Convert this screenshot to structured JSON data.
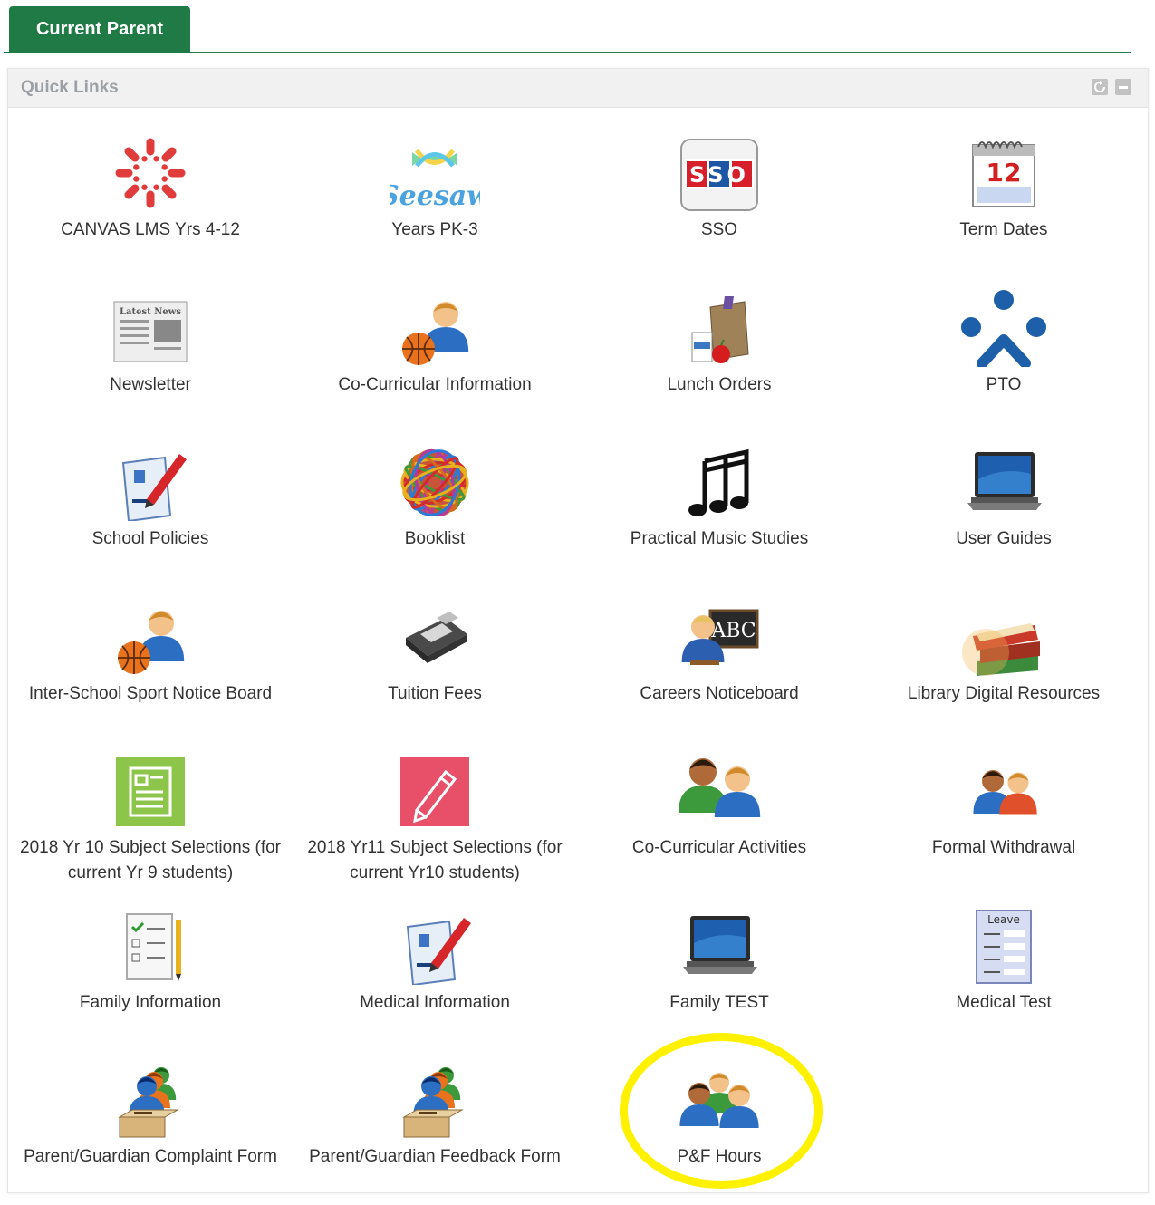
{
  "tab": {
    "label": "Current Parent"
  },
  "panel": {
    "title": "Quick Links"
  },
  "links": [
    {
      "label": "CANVAS LMS Yrs 4-12",
      "icon": "canvas-logo-icon"
    },
    {
      "label": "Years PK-3",
      "icon": "seesaw-logo-icon",
      "logo_text": "Seesaw"
    },
    {
      "label": "SSO",
      "icon": "sso-icon",
      "logo_text": "SSO"
    },
    {
      "label": "Term Dates",
      "icon": "calendar-icon",
      "logo_text": "12"
    },
    {
      "label": "Newsletter",
      "icon": "newspaper-icon",
      "logo_text": "Latest News"
    },
    {
      "label": "Co-Curricular Information",
      "icon": "person-basketball-icon"
    },
    {
      "label": "Lunch Orders",
      "icon": "lunch-bag-icon"
    },
    {
      "label": "PTO",
      "icon": "pto-logo-icon"
    },
    {
      "label": "School Policies",
      "icon": "document-pen-icon"
    },
    {
      "label": "Booklist",
      "icon": "rubber-band-ball-icon"
    },
    {
      "label": "Practical Music Studies",
      "icon": "music-notes-icon"
    },
    {
      "label": "User Guides",
      "icon": "laptop-icon"
    },
    {
      "label": "Inter-School Sport Notice Board",
      "icon": "person-basketball-icon"
    },
    {
      "label": "Tuition Fees",
      "icon": "card-terminal-icon"
    },
    {
      "label": "Careers Noticeboard",
      "icon": "teacher-abc-icon",
      "logo_text": "ABC"
    },
    {
      "label": "Library Digital Resources",
      "icon": "books-icon"
    },
    {
      "label": "2018 Yr 10 Subject Selections (for current Yr 9 students)",
      "icon": "green-document-icon"
    },
    {
      "label": "2018 Yr11 Subject Selections (for current Yr10 students)",
      "icon": "pink-pencil-icon"
    },
    {
      "label": "Co-Curricular Activities",
      "icon": "two-people-icon"
    },
    {
      "label": "Formal Withdrawal",
      "icon": "two-people-small-icon"
    },
    {
      "label": "Family Information",
      "icon": "checklist-icon"
    },
    {
      "label": "Medical Information",
      "icon": "document-pen-icon"
    },
    {
      "label": "Family TEST",
      "icon": "laptop-icon"
    },
    {
      "label": "Medical Test",
      "icon": "leave-form-icon",
      "logo_text": "Leave"
    },
    {
      "label": "Parent/Guardian Complaint Form",
      "icon": "people-ballot-icon"
    },
    {
      "label": "Parent/Guardian Feedback Form",
      "icon": "people-ballot-icon"
    },
    {
      "label": "P&F Hours",
      "icon": "three-people-icon"
    }
  ],
  "colors": {
    "tab": "#1f7a45",
    "highlight": "#fff100",
    "canvas_red": "#e13c3c",
    "pto_blue": "#1d5fa8"
  }
}
